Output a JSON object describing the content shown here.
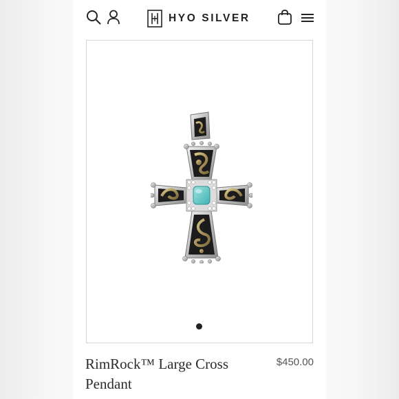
{
  "header": {
    "brand_name": "HYO SILVER",
    "brand_monogram": "H",
    "icons": [
      "search-icon",
      "account-icon",
      "cart-icon",
      "menu-icon"
    ]
  },
  "gallery": {
    "slide_count": 1,
    "active_slide": 1
  },
  "product": {
    "title": "RimRock™ Large Cross Pendant",
    "price": "$450.00"
  },
  "colors": {
    "text_dark": "#222222",
    "frame_border": "#d4d4d4",
    "turquoise": "#5ec4c3",
    "gold": "#b8a46a",
    "enamel_black": "#1c1c1c",
    "silver": "#c9c9c9"
  }
}
